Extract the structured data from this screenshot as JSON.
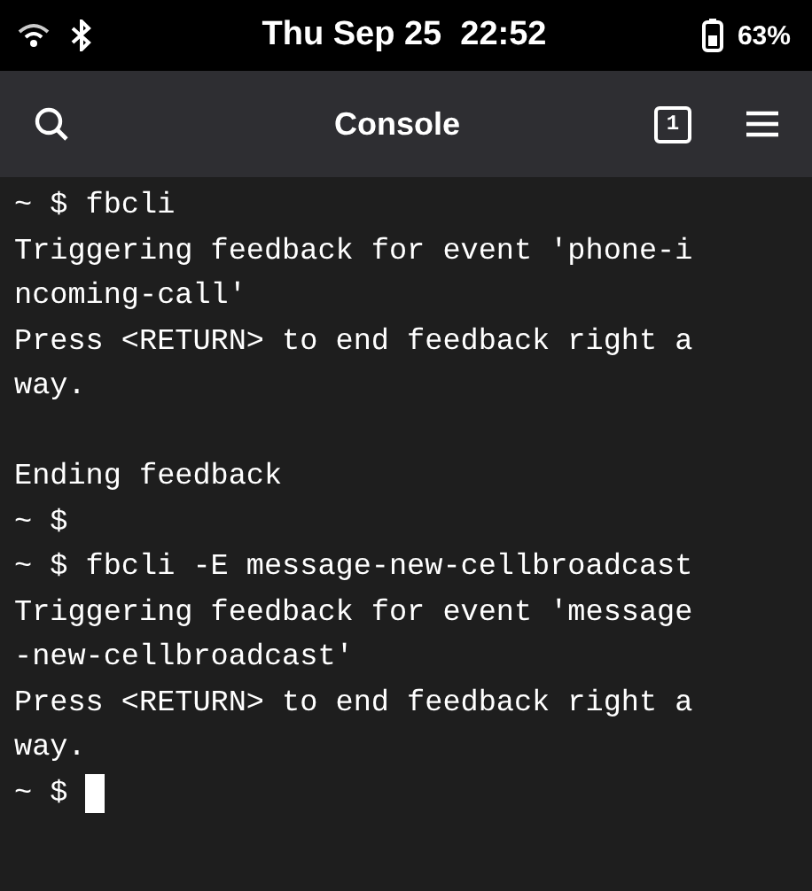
{
  "status_bar": {
    "clock": "Thu Sep 25  22:52",
    "battery": "63%"
  },
  "header": {
    "title": "Console",
    "tab_count": "1"
  },
  "terminal": {
    "cursor": true,
    "lines": [
      {
        "kind": "text",
        "text": "~ $ fbcli"
      },
      {
        "kind": "text",
        "text": "Triggering feedback for event 'phone-i"
      },
      {
        "kind": "text",
        "text": "ncoming-call'"
      },
      {
        "kind": "text",
        "text": "Press <RETURN> to end feedback right a"
      },
      {
        "kind": "text",
        "text": "way."
      },
      {
        "kind": "blank"
      },
      {
        "kind": "text",
        "text": "Ending feedback"
      },
      {
        "kind": "text",
        "text": "~ $"
      },
      {
        "kind": "text",
        "text": "~ $ fbcli -E message-new-cellbroadcast"
      },
      {
        "kind": "text",
        "text": "Triggering feedback for event 'message"
      },
      {
        "kind": "text",
        "text": "-new-cellbroadcast'"
      },
      {
        "kind": "text",
        "text": "Press <RETURN> to end feedback right a"
      },
      {
        "kind": "text",
        "text": "way."
      },
      {
        "kind": "text",
        "text": "~ $"
      }
    ]
  }
}
